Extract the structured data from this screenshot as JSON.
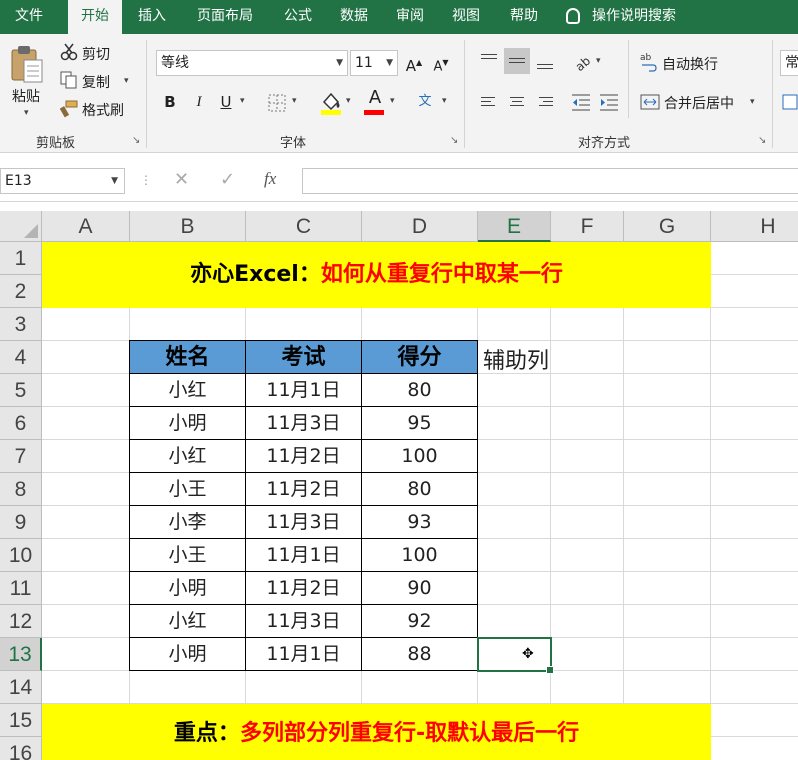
{
  "tabs": [
    "文件",
    "开始",
    "插入",
    "页面布局",
    "公式",
    "数据",
    "审阅",
    "视图",
    "帮助"
  ],
  "active_tab": "开始",
  "tell_me": "操作说明搜索",
  "clipboard": {
    "paste": "粘贴",
    "cut": "剪切",
    "copy": "复制",
    "format_painter": "格式刷",
    "group_label": "剪贴板"
  },
  "font": {
    "font_name": "等线",
    "font_size": "11",
    "bold": "B",
    "italic": "I",
    "underline": "U",
    "font_color_letter": "A",
    "grow": "A",
    "shrink": "A",
    "phonetic": "文",
    "group_label": "字体",
    "highlight_color": "#ffff00",
    "font_color": "#ff0000"
  },
  "alignment": {
    "wrap_text": "自动换行",
    "merge_center": "合并后居中",
    "group_label": "对齐方式"
  },
  "number": {
    "format_partial": "常"
  },
  "formula_bar": {
    "name_box": "E13",
    "fx": "fx",
    "formula": ""
  },
  "columns": [
    "A",
    "B",
    "C",
    "D",
    "E",
    "F",
    "G",
    "H"
  ],
  "rows": [
    "1",
    "2",
    "3",
    "4",
    "5",
    "6",
    "7",
    "8",
    "9",
    "10",
    "11",
    "12",
    "13",
    "14",
    "15",
    "16"
  ],
  "selected_cell": "E13",
  "banner_top": {
    "prefix": "亦心Excel：",
    "text": "如何从重复行中取某一行"
  },
  "table": {
    "headers": [
      "姓名",
      "考试",
      "得分"
    ],
    "rows": [
      [
        "小红",
        "11月1日",
        "80"
      ],
      [
        "小明",
        "11月3日",
        "95"
      ],
      [
        "小红",
        "11月2日",
        "100"
      ],
      [
        "小王",
        "11月2日",
        "80"
      ],
      [
        "小李",
        "11月3日",
        "93"
      ],
      [
        "小王",
        "11月1日",
        "100"
      ],
      [
        "小明",
        "11月2日",
        "90"
      ],
      [
        "小红",
        "11月3日",
        "92"
      ],
      [
        "小明",
        "11月1日",
        "88"
      ]
    ]
  },
  "helper_column": "辅助列",
  "banner_bottom": {
    "prefix": "重点：",
    "text": "多列部分列重复行-取默认最后一行"
  },
  "colors": {
    "excel_green": "#217346",
    "header_blue": "#5b9bd5",
    "banner_yellow": "#ffff00",
    "accent_red": "#ff0000"
  }
}
